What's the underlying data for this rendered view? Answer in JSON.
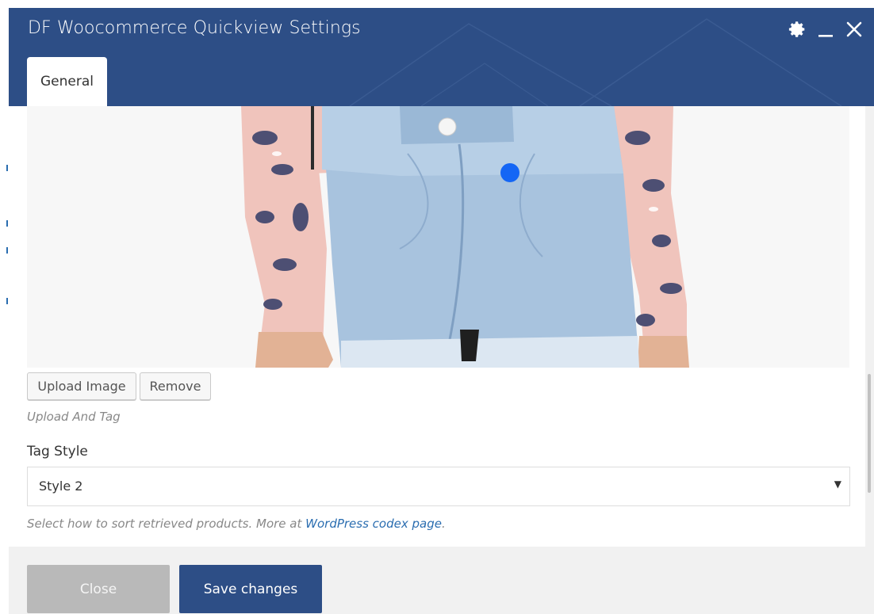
{
  "modal": {
    "title": "DF Woocommerce Quickview Settings"
  },
  "header_controls": {
    "settings_icon": "gear-icon",
    "minimize_icon": "minimize-icon",
    "close_icon": "close-icon"
  },
  "tabs": [
    {
      "label": "General",
      "active": true
    }
  ],
  "image_tagging": {
    "image_description": "product-photo",
    "tag_color": "#1466f5",
    "upload_label": "Upload Image",
    "remove_label": "Remove",
    "help_text": "Upload And Tag"
  },
  "tag_style": {
    "label": "Tag Style",
    "selected": "Style 2",
    "help_prefix": "Select how to sort retrieved products. More at ",
    "help_link": "WordPress codex page",
    "help_suffix": "."
  },
  "footer": {
    "close_label": "Close",
    "save_label": "Save changes"
  },
  "colors": {
    "header": "#2d4e86",
    "save_button": "#2d4e86",
    "close_button": "#b9b9b9",
    "link": "#2a6db0"
  }
}
